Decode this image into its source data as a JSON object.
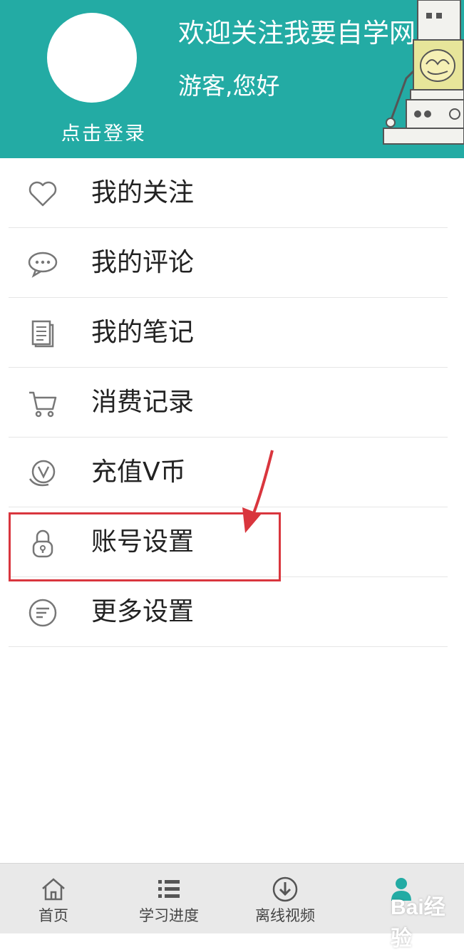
{
  "header": {
    "login_text": "点击登录",
    "welcome": "欢迎关注我要自学网",
    "guest": "游客,您好",
    "bg_color": "#23aba4"
  },
  "menu": {
    "items": [
      {
        "label": "我的关注",
        "icon": "heart-icon"
      },
      {
        "label": "我的评论",
        "icon": "comment-icon"
      },
      {
        "label": "我的笔记",
        "icon": "notes-icon"
      },
      {
        "label": "消费记录",
        "icon": "cart-icon"
      },
      {
        "label": "充值V币",
        "icon": "recharge-coin-icon"
      },
      {
        "label": "账号设置",
        "icon": "lock-icon"
      },
      {
        "label": "更多设置",
        "icon": "more-settings-icon"
      }
    ],
    "highlighted": "账号设置",
    "highlight_color": "#d9363e"
  },
  "tabbar": {
    "tabs": [
      {
        "label": "首页",
        "icon": "home-icon"
      },
      {
        "label": "学习进度",
        "icon": "list-icon"
      },
      {
        "label": "离线视频",
        "icon": "download-icon"
      },
      {
        "label": "",
        "icon": "profile-icon"
      }
    ]
  },
  "watermark": {
    "text": "Bai经验"
  }
}
